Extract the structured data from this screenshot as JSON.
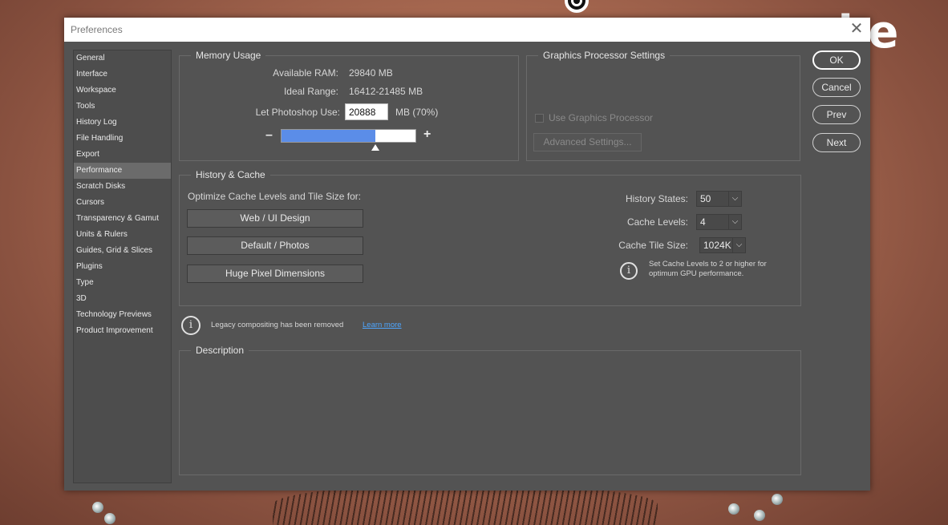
{
  "background": {
    "brand_text": "zke"
  },
  "dialog": {
    "title": "Preferences"
  },
  "sidebar": {
    "items": [
      {
        "label": "General"
      },
      {
        "label": "Interface"
      },
      {
        "label": "Workspace"
      },
      {
        "label": "Tools"
      },
      {
        "label": "History Log"
      },
      {
        "label": "File Handling"
      },
      {
        "label": "Export"
      },
      {
        "label": "Performance",
        "active": true
      },
      {
        "label": "Scratch Disks"
      },
      {
        "label": "Cursors"
      },
      {
        "label": "Transparency & Gamut"
      },
      {
        "label": "Units & Rulers"
      },
      {
        "label": "Guides, Grid & Slices"
      },
      {
        "label": "Plugins"
      },
      {
        "label": "Type"
      },
      {
        "label": "3D"
      },
      {
        "label": "Technology Previews"
      },
      {
        "label": "Product Improvement"
      }
    ]
  },
  "memory": {
    "title": "Memory Usage",
    "available_label": "Available RAM:",
    "available_value": "29840 MB",
    "ideal_label": "Ideal Range:",
    "ideal_value": "16412-21485 MB",
    "use_label": "Let Photoshop Use:",
    "use_value": "20888",
    "use_unit": "MB (70%)",
    "minus": "–",
    "plus": "+",
    "slider_fraction": 0.7
  },
  "gpu": {
    "title": "Graphics Processor Settings",
    "use_gpu_label": "Use Graphics Processor",
    "advanced_label": "Advanced Settings..."
  },
  "history_cache": {
    "title": "History & Cache",
    "optimize_label": "Optimize Cache Levels and Tile Size for:",
    "preset_web": "Web / UI Design",
    "preset_default": "Default / Photos",
    "preset_huge": "Huge Pixel Dimensions",
    "history_states_label": "History States:",
    "history_states_value": "50",
    "cache_levels_label": "Cache Levels:",
    "cache_levels_value": "4",
    "tile_size_label": "Cache Tile Size:",
    "tile_size_value": "1024K",
    "gpu_note_line1": "Set Cache Levels to 2 or higher for",
    "gpu_note_line2": "optimum GPU performance."
  },
  "legacy": {
    "message": "Legacy compositing has been removed",
    "link": "Learn more"
  },
  "description": {
    "title": "Description"
  },
  "buttons": {
    "ok": "OK",
    "cancel": "Cancel",
    "prev": "Prev",
    "next": "Next"
  },
  "colors": {
    "slider_fill": "#5b8de8",
    "link": "#4ea6ff",
    "dialog_bg": "#535353"
  }
}
